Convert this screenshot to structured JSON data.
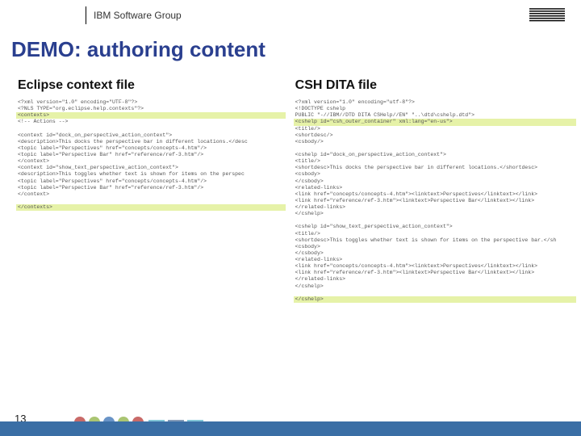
{
  "header": {
    "group": "IBM Software Group",
    "logo_alt": "IBM"
  },
  "title": "DEMO: authoring content",
  "page_number": "13",
  "left": {
    "heading": "Eclipse context file",
    "code": [
      {
        "t": "<?xml version=\"1.0\" encoding=\"UTF-8\"?>",
        "hl": false,
        "ind": 0
      },
      {
        "t": "<?NLS TYPE=\"org.eclipse.help.contexts\"?>",
        "hl": false,
        "ind": 0
      },
      {
        "t": "<contexts>",
        "hl": true,
        "ind": 0
      },
      {
        "t": "<!-- Actions -->",
        "hl": false,
        "ind": 1
      },
      {
        "t": " ",
        "hl": false,
        "ind": 0
      },
      {
        "t": "<context id=\"dock_on_perspective_action_context\">",
        "hl": false,
        "ind": 1
      },
      {
        "t": "<description>This docks the perspective bar in different locations.</desc",
        "hl": false,
        "ind": 2
      },
      {
        "t": "<topic label=\"Perspectives\" href=\"concepts/concepts-4.htm\"/>",
        "hl": false,
        "ind": 2
      },
      {
        "t": "<topic label=\"Perspective Bar\" href=\"reference/ref-3.htm\"/>",
        "hl": false,
        "ind": 2
      },
      {
        "t": "</context>",
        "hl": false,
        "ind": 1
      },
      {
        "t": "<context id=\"show_text_perspective_action_context\">",
        "hl": false,
        "ind": 1
      },
      {
        "t": "<description>This toggles whether text is shown for items on the perspec",
        "hl": false,
        "ind": 2
      },
      {
        "t": "<topic label=\"Perspectives\" href=\"concepts/concepts-4.htm\"/>",
        "hl": false,
        "ind": 2
      },
      {
        "t": "<topic label=\"Perspective Bar\" href=\"reference/ref-3.htm\"/>",
        "hl": false,
        "ind": 2
      },
      {
        "t": "</context>",
        "hl": false,
        "ind": 1
      },
      {
        "t": " ",
        "hl": false,
        "ind": 0
      },
      {
        "t": "</contexts>",
        "hl": true,
        "ind": 0
      }
    ]
  },
  "right": {
    "heading": "CSH DITA file",
    "code": [
      {
        "t": "<?xml version=\"1.0\" encoding=\"utf-8\"?>",
        "hl": false,
        "ind": 0
      },
      {
        "t": "<!DOCTYPE cshelp",
        "hl": false,
        "ind": 0
      },
      {
        "t": "PUBLIC \"-//IBM//DTD DITA CSHelp//EN\" \"..\\dtd\\cshelp.dtd\">",
        "hl": false,
        "ind": 2
      },
      {
        "t": "<cshelp id=\"csh_outer_container\" xml:lang=\"en-us\">",
        "hl": true,
        "ind": 0
      },
      {
        "t": "<title/>",
        "hl": false,
        "ind": 1
      },
      {
        "t": "<shortdesc/>",
        "hl": false,
        "ind": 1
      },
      {
        "t": "<csbody/>",
        "hl": false,
        "ind": 1
      },
      {
        "t": " ",
        "hl": false,
        "ind": 0
      },
      {
        "t": "<cshelp id=\"dock_on_perspective_action_context\">",
        "hl": false,
        "ind": 1
      },
      {
        "t": "<title/>",
        "hl": false,
        "ind": 2
      },
      {
        "t": "<shortdesc>This docks the perspective bar in different locations.</shortdesc>",
        "hl": false,
        "ind": 2
      },
      {
        "t": "<csbody>",
        "hl": false,
        "ind": 2
      },
      {
        "t": "</csbody>",
        "hl": false,
        "ind": 2
      },
      {
        "t": "<related-links>",
        "hl": false,
        "ind": 2
      },
      {
        "t": "<link href=\"concepts/concepts-4.htm\"><linktext>Perspectives</linktext></link>",
        "hl": false,
        "ind": 3
      },
      {
        "t": "<link href=\"reference/ref-3.htm\"><linktext>Perspective Bar</linktext></link>",
        "hl": false,
        "ind": 3
      },
      {
        "t": "</related-links>",
        "hl": false,
        "ind": 2
      },
      {
        "t": "</cshelp>",
        "hl": false,
        "ind": 1
      },
      {
        "t": " ",
        "hl": false,
        "ind": 0
      },
      {
        "t": "<cshelp id=\"show_text_perspective_action_context\">",
        "hl": false,
        "ind": 1
      },
      {
        "t": "<title/>",
        "hl": false,
        "ind": 2
      },
      {
        "t": "<shortdesc>This toggles whether text is shown for items on the perspective bar.</sh",
        "hl": false,
        "ind": 2
      },
      {
        "t": "<csbody>",
        "hl": false,
        "ind": 2
      },
      {
        "t": "</csbody>",
        "hl": false,
        "ind": 2
      },
      {
        "t": "<related-links>",
        "hl": false,
        "ind": 2
      },
      {
        "t": "<link href=\"concepts/concepts-4.htm\"><linktext>Perspectives</linktext></link>",
        "hl": false,
        "ind": 3
      },
      {
        "t": "<link href=\"reference/ref-3.htm\"><linktext>Perspective Bar</linktext></link>",
        "hl": false,
        "ind": 3
      },
      {
        "t": "</related-links>",
        "hl": false,
        "ind": 2
      },
      {
        "t": "</cshelp>",
        "hl": false,
        "ind": 1
      },
      {
        "t": " ",
        "hl": false,
        "ind": 0
      },
      {
        "t": "</cshelp>",
        "hl": true,
        "ind": 0
      }
    ]
  }
}
